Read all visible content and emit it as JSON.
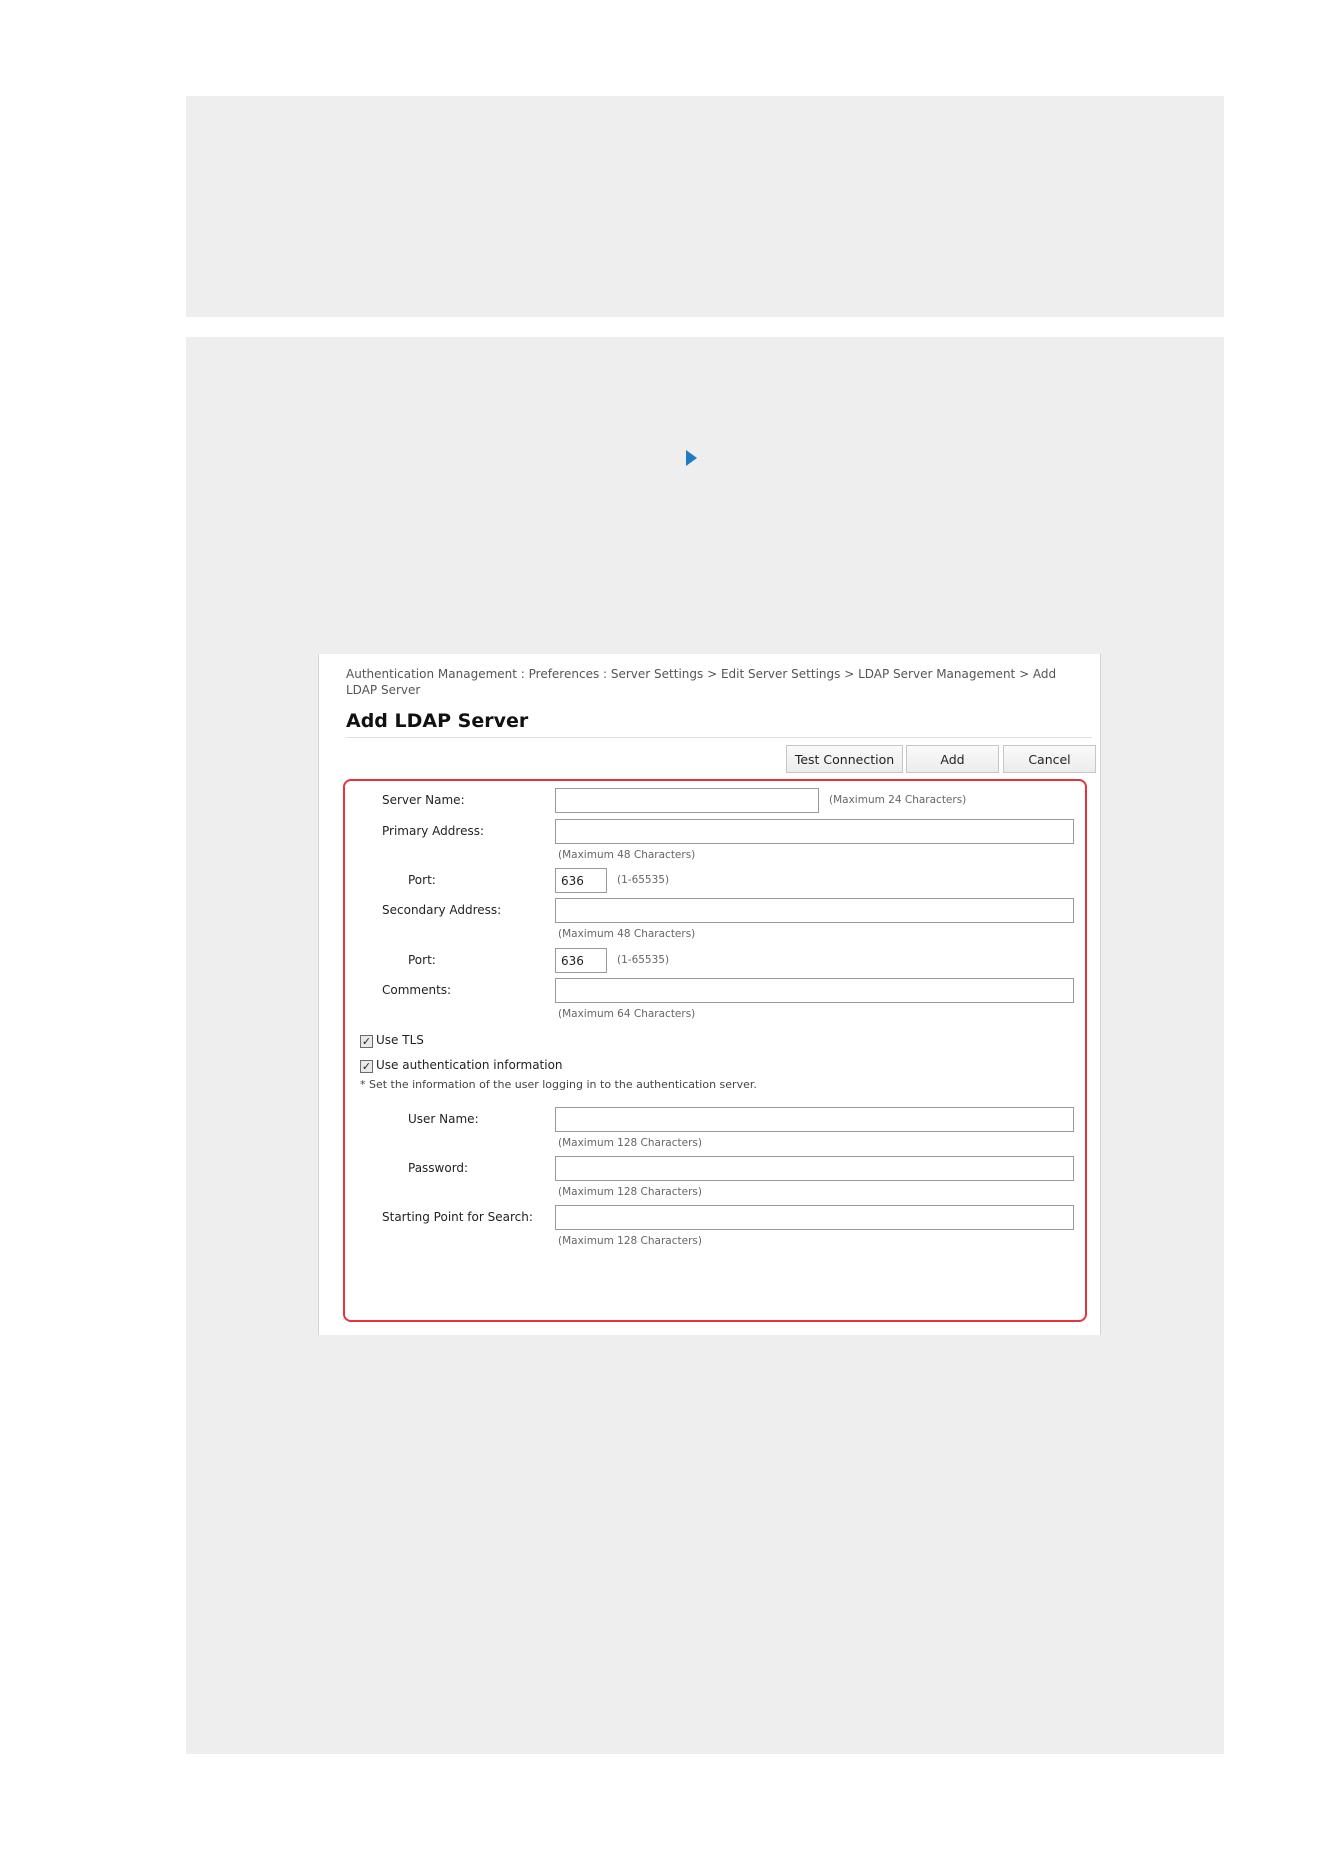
{
  "screen": {
    "breadcrumb": "Authentication Management : Preferences : Server Settings > Edit Server Settings > LDAP Server Management > Add LDAP Server",
    "title": "Add LDAP Server",
    "buttons": {
      "test": "Test Connection",
      "add": "Add",
      "cancel": "Cancel"
    }
  },
  "form": {
    "server_name": {
      "label": "Server Name:",
      "value": "",
      "hint": "(Maximum 24 Characters)"
    },
    "primary_address": {
      "label": "Primary Address:",
      "value": "",
      "hint": "(Maximum 48 Characters)"
    },
    "primary_port": {
      "label": "Port:",
      "value": "636",
      "hint": "(1-65535)"
    },
    "secondary_address": {
      "label": "Secondary Address:",
      "value": "",
      "hint": "(Maximum 48 Characters)"
    },
    "secondary_port": {
      "label": "Port:",
      "value": "636",
      "hint": "(1-65535)"
    },
    "comments": {
      "label": "Comments:",
      "value": "",
      "hint": "(Maximum 64 Characters)"
    },
    "use_tls": {
      "label": "Use TLS",
      "checked": true
    },
    "use_auth_info": {
      "label": "Use authentication information",
      "checked": true
    },
    "auth_note": "* Set the information of the user logging in to the authentication server.",
    "user_name": {
      "label": "User Name:",
      "value": "",
      "hint": "(Maximum 128 Characters)"
    },
    "password": {
      "label": "Password:",
      "value": "",
      "hint": "(Maximum 128 Characters)"
    },
    "search_start": {
      "label": "Starting Point for Search:",
      "value": "",
      "hint": "(Maximum 128 Characters)"
    }
  },
  "check_glyph": "✓",
  "colors": {
    "highlight": "#e8323c",
    "arrow": "#1e7ac2",
    "panel": "#eeeeee"
  },
  "icons": {
    "step_arrow": "play-arrow-icon",
    "checkbox": "checkbox-checked-icon"
  }
}
